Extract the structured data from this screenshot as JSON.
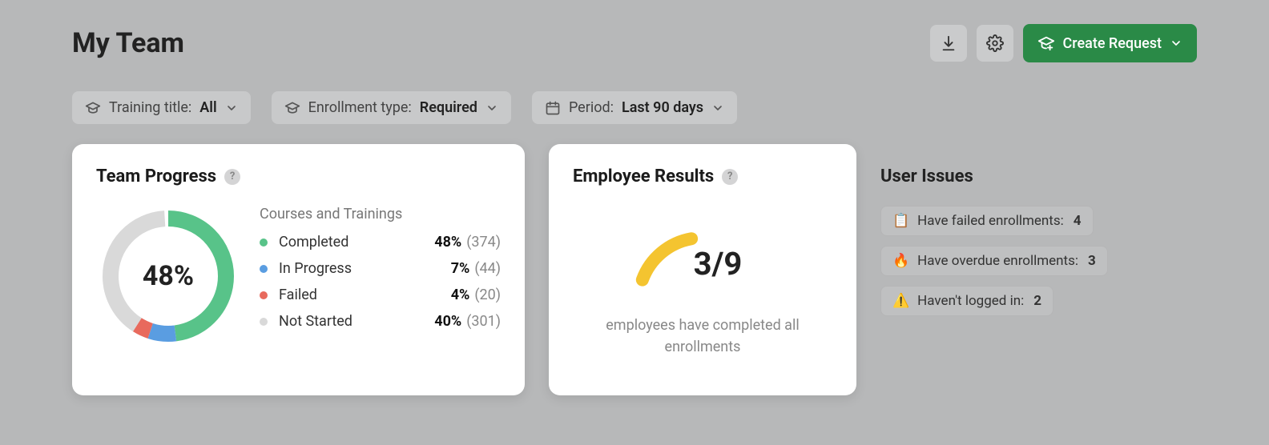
{
  "header": {
    "title": "My Team",
    "create_label": "Create Request"
  },
  "filters": {
    "training_label": "Training title:",
    "training_value": "All",
    "enrollment_label": "Enrollment type:",
    "enrollment_value": "Required",
    "period_label": "Period:",
    "period_value": "Last 90 days"
  },
  "team_progress": {
    "title": "Team Progress",
    "center_value": "48%",
    "legend_heading": "Courses and Trainings",
    "items": [
      {
        "label": "Completed",
        "pct": "48%",
        "count": "(374)",
        "color": "#58c389"
      },
      {
        "label": "In Progress",
        "pct": "7%",
        "count": "(44)",
        "color": "#5a9de1"
      },
      {
        "label": "Failed",
        "pct": "4%",
        "count": "(20)",
        "color": "#e86a5d"
      },
      {
        "label": "Not Started",
        "pct": "40%",
        "count": "(301)",
        "color": "#d9d9d9"
      }
    ]
  },
  "employee_results": {
    "title": "Employee Results",
    "value": "3/9",
    "caption": "employees have completed all enrollments"
  },
  "user_issues": {
    "title": "User Issues",
    "items": [
      {
        "icon": "📋",
        "label": "Have failed enrollments:",
        "count": "4"
      },
      {
        "icon": "🔥",
        "label": "Have overdue enrollments:",
        "count": "3"
      },
      {
        "icon": "⚠️",
        "label": "Haven't logged in:",
        "count": "2"
      }
    ]
  },
  "chart_data": [
    {
      "type": "pie",
      "title": "Team Progress — Courses and Trainings",
      "categories": [
        "Completed",
        "In Progress",
        "Failed",
        "Not Started"
      ],
      "values": [
        48,
        7,
        4,
        40
      ],
      "counts": [
        374,
        44,
        20,
        301
      ],
      "colors": [
        "#58c389",
        "#5a9de1",
        "#e86a5d",
        "#d9d9d9"
      ],
      "center_label": "48%"
    },
    {
      "type": "gauge",
      "title": "Employee Results",
      "value": 3,
      "max": 9,
      "fraction": 0.333,
      "display": "3/9",
      "caption": "employees have completed all enrollments",
      "color": "#f4c430"
    }
  ]
}
